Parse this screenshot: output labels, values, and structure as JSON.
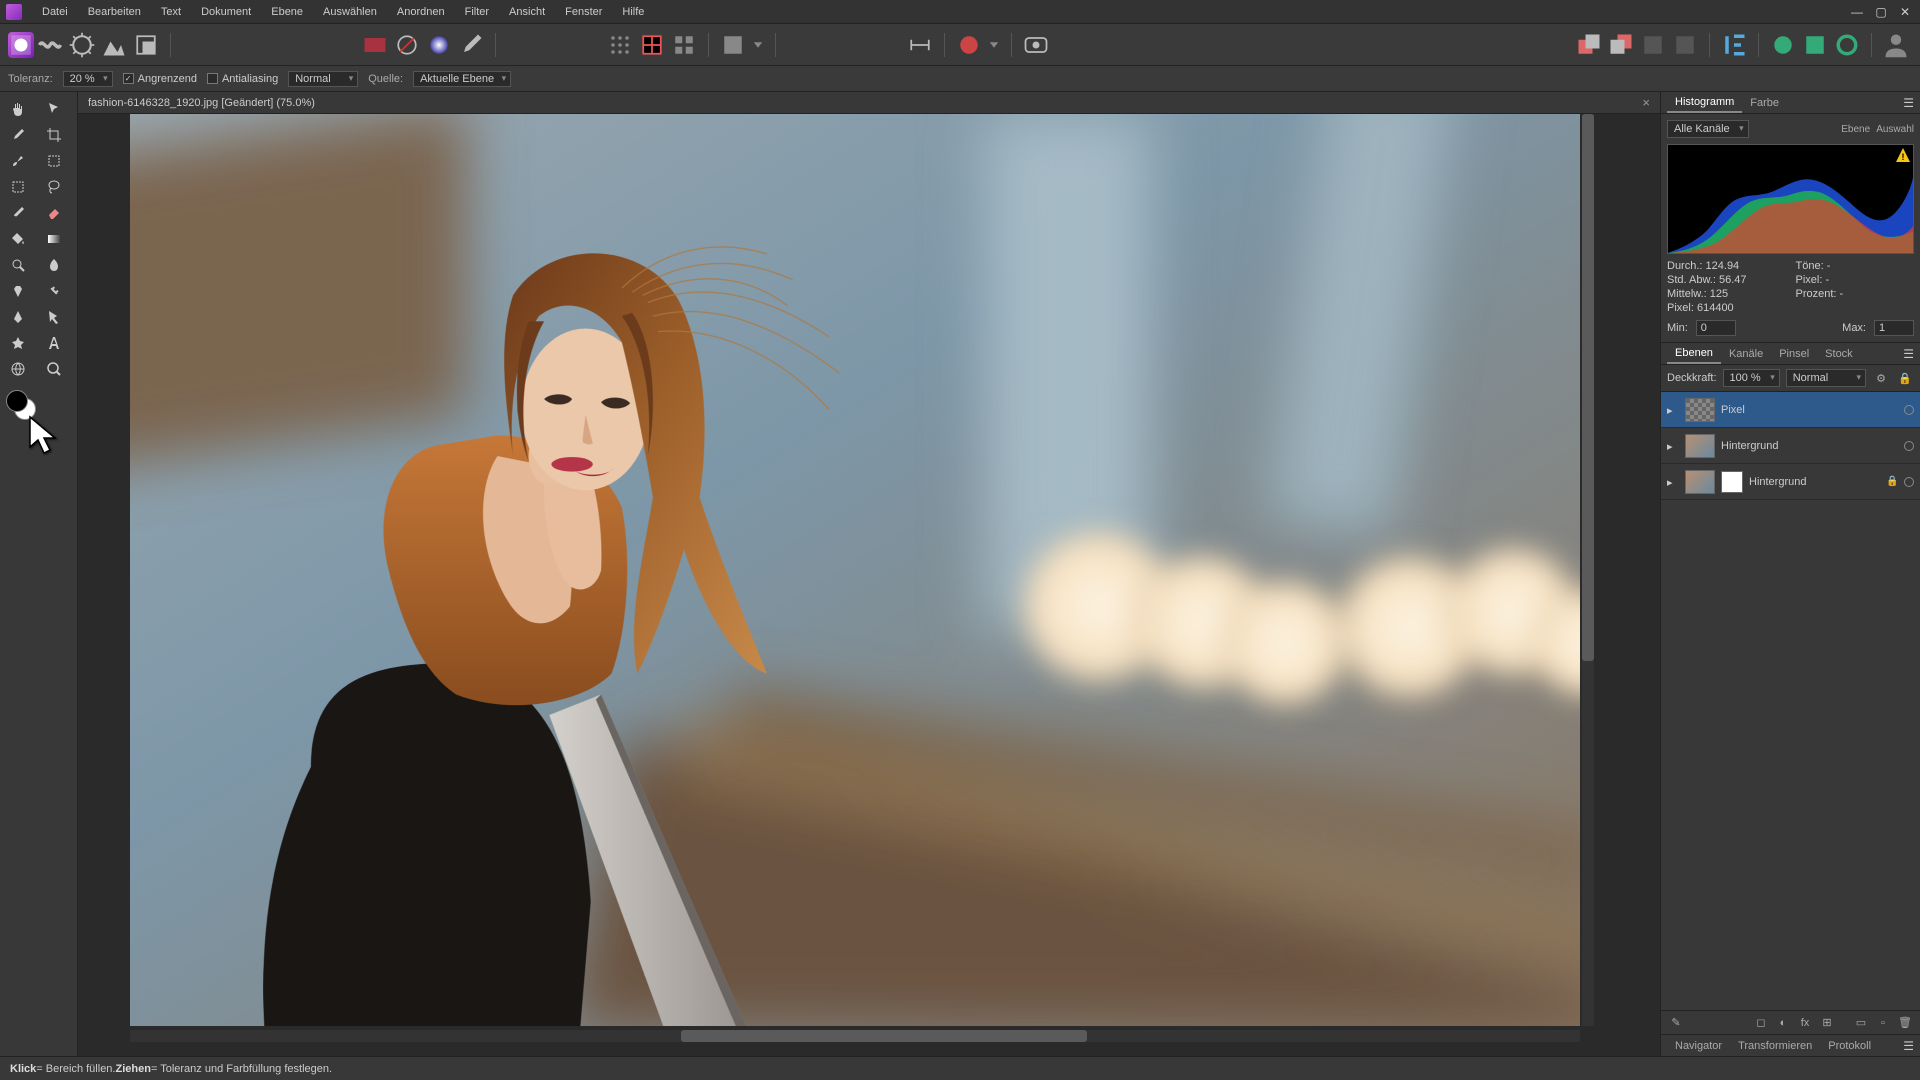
{
  "menu": [
    "Datei",
    "Bearbeiten",
    "Text",
    "Dokument",
    "Ebene",
    "Auswählen",
    "Anordnen",
    "Filter",
    "Ansicht",
    "Fenster",
    "Hilfe"
  ],
  "context": {
    "tolerance_label": "Toleranz:",
    "tolerance_value": "20 %",
    "contiguous": "Angrenzend",
    "antialias": "Antialiasing",
    "blend": "Normal",
    "source_label": "Quelle:",
    "source_value": "Aktuelle Ebene"
  },
  "document": {
    "tab": "fashion-6146328_1920.jpg [Geändert] (75.0%)"
  },
  "histogram": {
    "tabs": [
      "Histogramm",
      "Farbe"
    ],
    "channel": "Alle Kanäle",
    "scope_layer": "Ebene",
    "scope_selection": "Auswahl",
    "mean_label": "Durch.:",
    "mean": "124.94",
    "std_label": "Std. Abw.:",
    "std": "56.47",
    "median_label": "Mittelw.:",
    "median": "125",
    "pixels_label": "Pixel:",
    "pixels": "614400",
    "tone_label": "Töne:",
    "tone": "-",
    "pixel2_label": "Pixel:",
    "pixel2": "-",
    "percent_label": "Prozent:",
    "percent": "-",
    "min_label": "Min:",
    "min": "0",
    "max_label": "Max:",
    "max": "1"
  },
  "layers": {
    "tabs": [
      "Ebenen",
      "Kanäle",
      "Pinsel",
      "Stock"
    ],
    "opacity_label": "Deckkraft:",
    "opacity": "100 %",
    "blend": "Normal",
    "items": [
      {
        "name": "Pixel",
        "selected": true,
        "checker": true,
        "mask": false,
        "locked": false
      },
      {
        "name": "Hintergrund",
        "selected": false,
        "checker": false,
        "mask": false,
        "locked": false
      },
      {
        "name": "Hintergrund",
        "selected": false,
        "checker": false,
        "mask": true,
        "locked": true
      }
    ]
  },
  "bottom_tabs": [
    "Navigator",
    "Transformieren",
    "Protokoll"
  ],
  "status": {
    "click": "Klick",
    "click_txt": " = Bereich füllen. ",
    "drag": "Ziehen",
    "drag_txt": " = Toleranz und Farbfüllung festlegen."
  }
}
